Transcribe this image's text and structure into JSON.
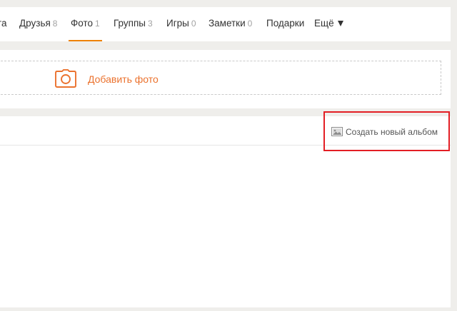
{
  "nav": {
    "items": [
      {
        "label": "та",
        "count": ""
      },
      {
        "label": "Друзья",
        "count": "8"
      },
      {
        "label": "Фото",
        "count": "1",
        "active": true
      },
      {
        "label": "Группы",
        "count": "3"
      },
      {
        "label": "Игры",
        "count": "0"
      },
      {
        "label": "Заметки",
        "count": "0"
      },
      {
        "label": "Подарки",
        "count": ""
      },
      {
        "label": "Ещё",
        "count": ""
      }
    ],
    "accent": "#ee8208"
  },
  "photos": {
    "add_label": "Добавить фото",
    "accent": "#eb722e"
  },
  "albums": {
    "create_label": "Создать новый альбом",
    "highlight_color": "#e31e24"
  }
}
